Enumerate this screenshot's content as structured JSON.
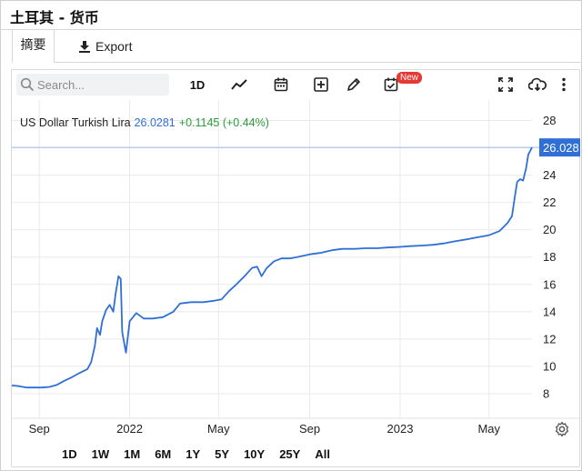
{
  "window": {
    "title": "土耳其 - 货币"
  },
  "tabs": {
    "summary": "摘要",
    "export": "Export"
  },
  "toolbar": {
    "search_placeholder": "Search...",
    "interval": "1D",
    "new_badge": "New"
  },
  "quote": {
    "name": "US Dollar Turkish Lira",
    "price": "26.0281",
    "change": "+0.1145 (+0.44%)",
    "last_price_label": "26.028"
  },
  "range": {
    "buttons": [
      "1D",
      "1W",
      "1M",
      "6M",
      "1Y",
      "5Y",
      "10Y",
      "25Y",
      "All"
    ]
  },
  "colors": {
    "line": "#2f6fd6",
    "positive": "#2a9d3a",
    "price_tag": "#2f6fd6",
    "badge": "#e53935"
  },
  "chart_data": {
    "type": "line",
    "title": "",
    "xlabel": "",
    "ylabel": "",
    "ylim": [
      6.2,
      29.5
    ],
    "yticks": [
      8,
      10,
      12,
      14,
      16,
      18,
      20,
      22,
      24,
      26,
      28
    ],
    "x_range": [
      "2021-07-26",
      "2023-06-28"
    ],
    "xticks": [
      {
        "date": "2021-09-01",
        "label": "Sep"
      },
      {
        "date": "2022-01-01",
        "label": "2022"
      },
      {
        "date": "2022-05-01",
        "label": "May"
      },
      {
        "date": "2022-09-01",
        "label": "Sep"
      },
      {
        "date": "2023-01-01",
        "label": "2023"
      },
      {
        "date": "2023-05-01",
        "label": "May"
      }
    ],
    "grid": true,
    "series": [
      {
        "name": "US Dollar Turkish Lira",
        "points": [
          [
            "2021-07-26",
            8.6
          ],
          [
            "2021-08-05",
            8.55
          ],
          [
            "2021-08-15",
            8.45
          ],
          [
            "2021-08-25",
            8.45
          ],
          [
            "2021-09-05",
            8.45
          ],
          [
            "2021-09-15",
            8.5
          ],
          [
            "2021-09-25",
            8.65
          ],
          [
            "2021-10-05",
            8.95
          ],
          [
            "2021-10-15",
            9.2
          ],
          [
            "2021-10-25",
            9.5
          ],
          [
            "2021-11-05",
            9.8
          ],
          [
            "2021-11-10",
            10.3
          ],
          [
            "2021-11-15",
            11.5
          ],
          [
            "2021-11-18",
            12.8
          ],
          [
            "2021-11-22",
            12.3
          ],
          [
            "2021-11-25",
            13.3
          ],
          [
            "2021-11-30",
            14.1
          ],
          [
            "2021-12-05",
            14.5
          ],
          [
            "2021-12-10",
            14.0
          ],
          [
            "2021-12-13",
            15.3
          ],
          [
            "2021-12-17",
            16.6
          ],
          [
            "2021-12-20",
            16.4
          ],
          [
            "2021-12-22",
            12.5
          ],
          [
            "2021-12-27",
            11.0
          ],
          [
            "2022-01-01",
            13.3
          ],
          [
            "2022-01-10",
            13.9
          ],
          [
            "2022-01-20",
            13.5
          ],
          [
            "2022-02-01",
            13.5
          ],
          [
            "2022-02-15",
            13.6
          ],
          [
            "2022-03-01",
            14.0
          ],
          [
            "2022-03-10",
            14.6
          ],
          [
            "2022-03-25",
            14.7
          ],
          [
            "2022-04-10",
            14.7
          ],
          [
            "2022-04-25",
            14.8
          ],
          [
            "2022-05-05",
            14.9
          ],
          [
            "2022-05-15",
            15.5
          ],
          [
            "2022-05-25",
            16.0
          ],
          [
            "2022-06-05",
            16.6
          ],
          [
            "2022-06-15",
            17.2
          ],
          [
            "2022-06-22",
            17.3
          ],
          [
            "2022-06-28",
            16.6
          ],
          [
            "2022-07-05",
            17.2
          ],
          [
            "2022-07-15",
            17.7
          ],
          [
            "2022-07-25",
            17.9
          ],
          [
            "2022-08-05",
            17.9
          ],
          [
            "2022-08-15",
            18.0
          ],
          [
            "2022-09-01",
            18.2
          ],
          [
            "2022-09-15",
            18.3
          ],
          [
            "2022-10-01",
            18.5
          ],
          [
            "2022-10-15",
            18.6
          ],
          [
            "2022-11-01",
            18.6
          ],
          [
            "2022-11-15",
            18.65
          ],
          [
            "2022-12-01",
            18.65
          ],
          [
            "2022-12-15",
            18.7
          ],
          [
            "2023-01-01",
            18.75
          ],
          [
            "2023-01-15",
            18.8
          ],
          [
            "2023-02-01",
            18.85
          ],
          [
            "2023-02-15",
            18.9
          ],
          [
            "2023-03-01",
            19.0
          ],
          [
            "2023-03-15",
            19.15
          ],
          [
            "2023-04-01",
            19.3
          ],
          [
            "2023-04-15",
            19.45
          ],
          [
            "2023-05-01",
            19.6
          ],
          [
            "2023-05-15",
            19.9
          ],
          [
            "2023-05-26",
            20.5
          ],
          [
            "2023-06-01",
            21.0
          ],
          [
            "2023-06-05",
            22.5
          ],
          [
            "2023-06-08",
            23.5
          ],
          [
            "2023-06-12",
            23.7
          ],
          [
            "2023-06-16",
            23.6
          ],
          [
            "2023-06-20",
            24.5
          ],
          [
            "2023-06-23",
            25.5
          ],
          [
            "2023-06-28",
            26.0281
          ]
        ]
      }
    ]
  }
}
